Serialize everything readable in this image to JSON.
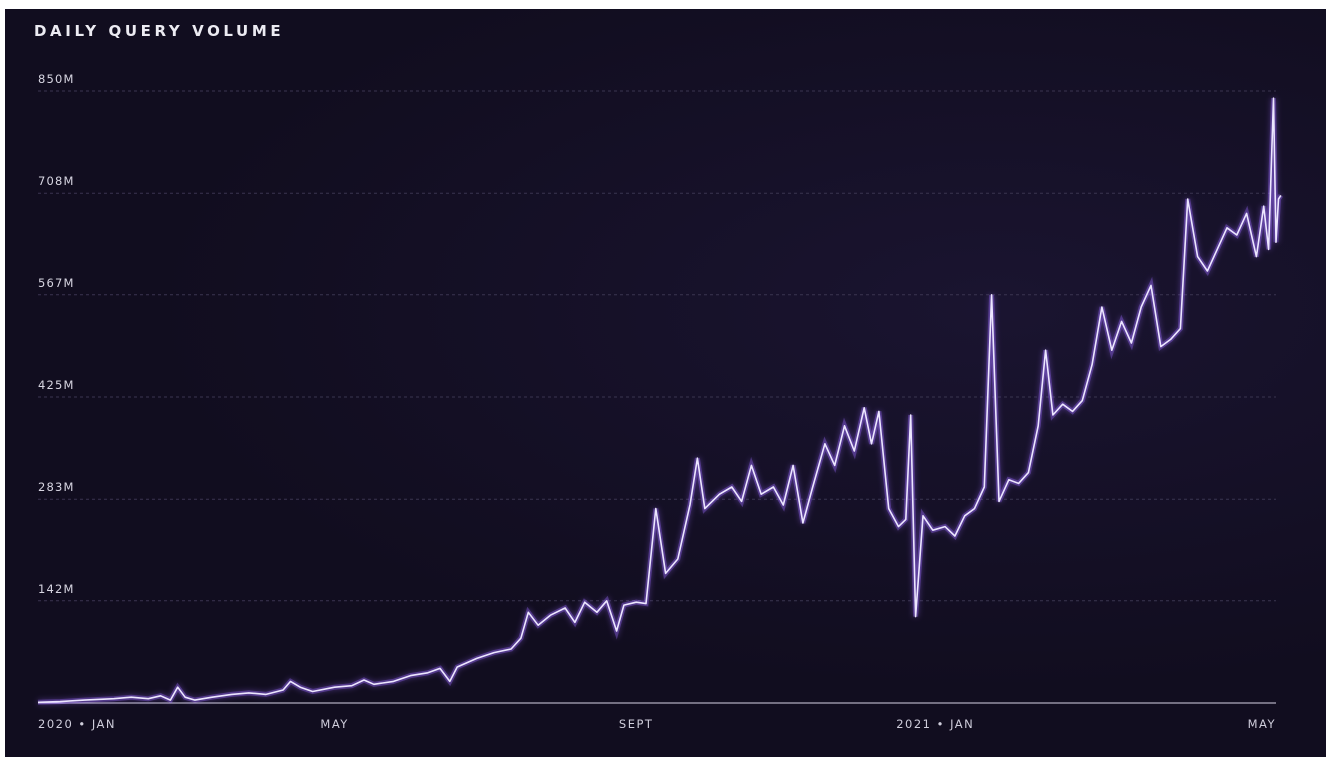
{
  "chart_data": {
    "type": "line",
    "title": "DAILY QUERY VOLUME",
    "xlabel": "",
    "ylabel": "",
    "y_unit": "M",
    "y_ticks": [
      "850M",
      "708M",
      "567M",
      "425M",
      "283M",
      "142M"
    ],
    "y_tick_values": [
      850,
      708,
      567,
      425,
      283,
      142
    ],
    "ylim": [
      0,
      850
    ],
    "x_ticks": [
      "2020 • JAN",
      "MAY",
      "SEPT",
      "2021 • JAN",
      "MAY"
    ],
    "x_tick_dates": [
      "2020-01-01",
      "2020-05-01",
      "2020-09-01",
      "2021-01-01",
      "2021-05-01"
    ],
    "xlim": [
      "2020-01-01",
      "2021-05-20"
    ],
    "grid": true,
    "line_color": "#ece6ff",
    "glow_color": "#9b6bff",
    "series": [
      {
        "points": [
          [
            "2020-01-01",
            1
          ],
          [
            "2020-01-10",
            2
          ],
          [
            "2020-01-20",
            4
          ],
          [
            "2020-02-01",
            6
          ],
          [
            "2020-02-08",
            8
          ],
          [
            "2020-02-15",
            6
          ],
          [
            "2020-02-20",
            10
          ],
          [
            "2020-02-24",
            4
          ],
          [
            "2020-02-27",
            22
          ],
          [
            "2020-03-01",
            8
          ],
          [
            "2020-03-05",
            4
          ],
          [
            "2020-03-12",
            8
          ],
          [
            "2020-03-20",
            12
          ],
          [
            "2020-03-27",
            14
          ],
          [
            "2020-04-03",
            12
          ],
          [
            "2020-04-10",
            18
          ],
          [
            "2020-04-13",
            30
          ],
          [
            "2020-04-17",
            22
          ],
          [
            "2020-04-22",
            16
          ],
          [
            "2020-05-01",
            22
          ],
          [
            "2020-05-08",
            24
          ],
          [
            "2020-05-13",
            32
          ],
          [
            "2020-05-17",
            26
          ],
          [
            "2020-05-25",
            30
          ],
          [
            "2020-06-01",
            38
          ],
          [
            "2020-06-08",
            42
          ],
          [
            "2020-06-13",
            48
          ],
          [
            "2020-06-17",
            30
          ],
          [
            "2020-06-20",
            50
          ],
          [
            "2020-06-28",
            62
          ],
          [
            "2020-07-05",
            70
          ],
          [
            "2020-07-12",
            75
          ],
          [
            "2020-07-16",
            90
          ],
          [
            "2020-07-19",
            126
          ],
          [
            "2020-07-23",
            108
          ],
          [
            "2020-07-28",
            122
          ],
          [
            "2020-08-03",
            132
          ],
          [
            "2020-08-07",
            112
          ],
          [
            "2020-08-11",
            140
          ],
          [
            "2020-08-16",
            126
          ],
          [
            "2020-08-20",
            142
          ],
          [
            "2020-08-24",
            100
          ],
          [
            "2020-08-27",
            136
          ],
          [
            "2020-09-01",
            140
          ],
          [
            "2020-09-05",
            138
          ],
          [
            "2020-09-09",
            270
          ],
          [
            "2020-09-13",
            180
          ],
          [
            "2020-09-18",
            200
          ],
          [
            "2020-09-23",
            276
          ],
          [
            "2020-09-26",
            340
          ],
          [
            "2020-09-29",
            270
          ],
          [
            "2020-10-05",
            290
          ],
          [
            "2020-10-10",
            300
          ],
          [
            "2020-10-14",
            280
          ],
          [
            "2020-10-18",
            330
          ],
          [
            "2020-10-22",
            290
          ],
          [
            "2020-10-27",
            300
          ],
          [
            "2020-10-31",
            275
          ],
          [
            "2020-11-04",
            330
          ],
          [
            "2020-11-08",
            250
          ],
          [
            "2020-11-12",
            300
          ],
          [
            "2020-11-17",
            360
          ],
          [
            "2020-11-21",
            330
          ],
          [
            "2020-11-25",
            385
          ],
          [
            "2020-11-29",
            350
          ],
          [
            "2020-12-03",
            410
          ],
          [
            "2020-12-06",
            360
          ],
          [
            "2020-12-09",
            405
          ],
          [
            "2020-12-13",
            270
          ],
          [
            "2020-12-17",
            245
          ],
          [
            "2020-12-20",
            255
          ],
          [
            "2020-12-22",
            400
          ],
          [
            "2020-12-24",
            120
          ],
          [
            "2020-12-27",
            260
          ],
          [
            "2020-12-31",
            240
          ],
          [
            "2021-01-05",
            245
          ],
          [
            "2021-01-09",
            232
          ],
          [
            "2021-01-13",
            260
          ],
          [
            "2021-01-17",
            270
          ],
          [
            "2021-01-21",
            300
          ],
          [
            "2021-01-24",
            567
          ],
          [
            "2021-01-27",
            280
          ],
          [
            "2021-01-31",
            310
          ],
          [
            "2021-02-04",
            305
          ],
          [
            "2021-02-08",
            320
          ],
          [
            "2021-02-12",
            385
          ],
          [
            "2021-02-15",
            490
          ],
          [
            "2021-02-18",
            400
          ],
          [
            "2021-02-22",
            415
          ],
          [
            "2021-02-26",
            405
          ],
          [
            "2021-03-02",
            420
          ],
          [
            "2021-03-06",
            470
          ],
          [
            "2021-03-10",
            550
          ],
          [
            "2021-03-14",
            490
          ],
          [
            "2021-03-18",
            530
          ],
          [
            "2021-03-22",
            500
          ],
          [
            "2021-03-26",
            550
          ],
          [
            "2021-03-30",
            580
          ],
          [
            "2021-04-03",
            495
          ],
          [
            "2021-04-07",
            505
          ],
          [
            "2021-04-11",
            520
          ],
          [
            "2021-04-14",
            700
          ],
          [
            "2021-04-18",
            620
          ],
          [
            "2021-04-22",
            600
          ],
          [
            "2021-04-26",
            630
          ],
          [
            "2021-04-30",
            660
          ],
          [
            "2021-05-04",
            650
          ],
          [
            "2021-05-08",
            680
          ],
          [
            "2021-05-12",
            620
          ],
          [
            "2021-05-15",
            690
          ],
          [
            "2021-05-17",
            630
          ],
          [
            "2021-05-19",
            840
          ],
          [
            "2021-05-20",
            640
          ],
          [
            "2021-05-21",
            700
          ],
          [
            "2021-05-22",
            705
          ]
        ]
      }
    ]
  }
}
